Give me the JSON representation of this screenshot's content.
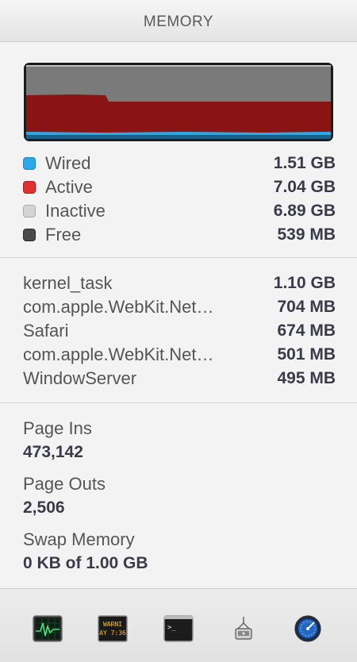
{
  "header": {
    "title": "MEMORY"
  },
  "colors": {
    "wired": "#2aa9e8",
    "active": "#e03030",
    "inactive": "#c8c8c8",
    "free": "#4a4a4a",
    "graph_active": "#8a1414",
    "graph_inactive": "#7a7a7a"
  },
  "legend": [
    {
      "label": "Wired",
      "value": "1.51 GB"
    },
    {
      "label": "Active",
      "value": "7.04 GB"
    },
    {
      "label": "Inactive",
      "value": "6.89 GB"
    },
    {
      "label": "Free",
      "value": "539 MB"
    }
  ],
  "processes": [
    {
      "name": "kernel_task",
      "value": "1.10 GB"
    },
    {
      "name": "com.apple.WebKit.Net…",
      "value": "704 MB"
    },
    {
      "name": "Safari",
      "value": "674 MB"
    },
    {
      "name": "com.apple.WebKit.Net…",
      "value": "501 MB"
    },
    {
      "name": "WindowServer",
      "value": "495 MB"
    }
  ],
  "stats": {
    "page_ins_label": "Page Ins",
    "page_ins_value": "473,142",
    "page_outs_label": "Page Outs",
    "page_outs_value": "2,506",
    "swap_label": "Swap Memory",
    "swap_value": "0 KB of 1.00 GB"
  },
  "footer": {
    "icons": [
      "activity-monitor-icon",
      "console-icon",
      "terminal-icon",
      "system-information-icon",
      "disk-utility-icon"
    ],
    "console_text_1": "WARNI",
    "console_text_2": "AY 7:36",
    "terminal_text": ">_"
  }
}
